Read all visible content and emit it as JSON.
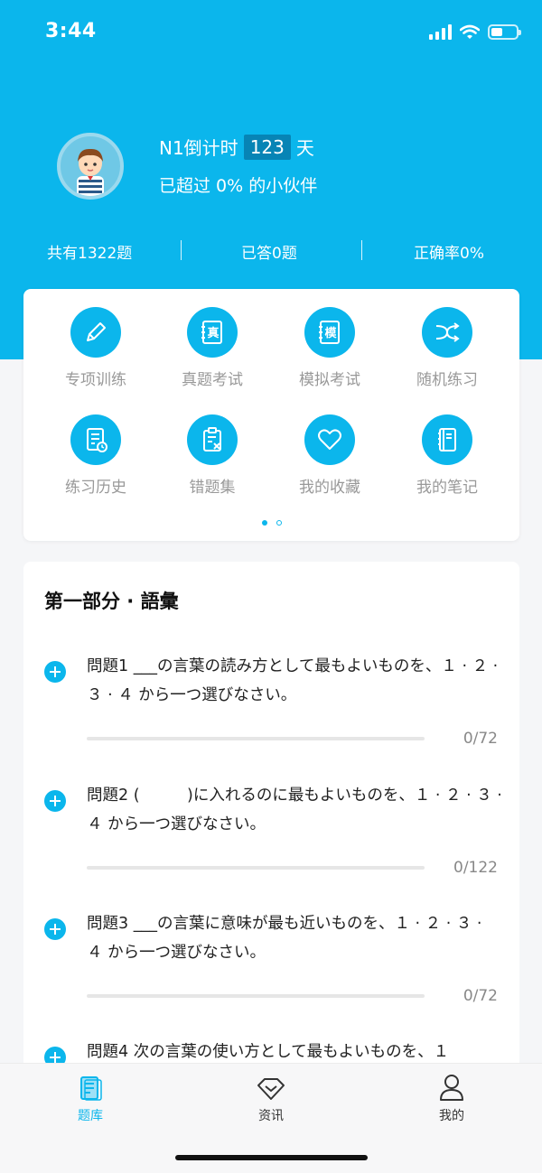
{
  "status_bar": {
    "time": "3:44"
  },
  "profile": {
    "countdown_label": "N1倒计时",
    "countdown_days": "123",
    "countdown_unit": "天",
    "surpass_text": "已超过 0% 的小伙伴"
  },
  "stats": {
    "total": "共有1322题",
    "sep1": "|",
    "answered": "已答0题",
    "sep2": "|",
    "accuracy": "正确率0%"
  },
  "grid": {
    "items": [
      {
        "label": "专项训练",
        "icon": "pencil-icon"
      },
      {
        "label": "真题考试",
        "icon": "real-exam-icon",
        "glyph": "真"
      },
      {
        "label": "模拟考试",
        "icon": "mock-exam-icon",
        "glyph": "模"
      },
      {
        "label": "随机练习",
        "icon": "shuffle-icon"
      },
      {
        "label": "练习历史",
        "icon": "history-icon"
      },
      {
        "label": "错题集",
        "icon": "wrong-list-icon"
      },
      {
        "label": "我的收藏",
        "icon": "heart-icon"
      },
      {
        "label": "我的笔记",
        "icon": "notebook-icon"
      }
    ],
    "page_count": 2,
    "current_page": 1
  },
  "section": {
    "title": "第一部分 · 語彙",
    "questions": [
      {
        "text": "問題1 ___の言葉の読み方として最もよいものを、１ · ２ · ３ · ４ から一つ選びなさい。",
        "progress": "0/72",
        "fraction": 0
      },
      {
        "text": "問題2 (　　　)に入れるのに最もよいものを、１ · ２ · ３ · ４ から一つ選びなさい。",
        "progress": "0/122",
        "fraction": 0
      },
      {
        "text": "問題3 ___の言葉に意味が最も近いものを、１ · ２ · ３ · ４ から一つ選びなさい。",
        "progress": "0/72",
        "fraction": 0
      },
      {
        "text": "問題4 次の言葉の使い方として最もよいものを、１",
        "progress": "",
        "fraction": 0
      }
    ]
  },
  "tabbar": {
    "items": [
      {
        "label": "题库",
        "icon": "question-bank-icon",
        "active": true
      },
      {
        "label": "资讯",
        "icon": "news-icon",
        "active": false
      },
      {
        "label": "我的",
        "icon": "profile-icon",
        "active": false
      }
    ]
  },
  "colors": {
    "accent": "#0bb6ec",
    "accent_dark": "#0784b5",
    "muted": "#999999"
  }
}
